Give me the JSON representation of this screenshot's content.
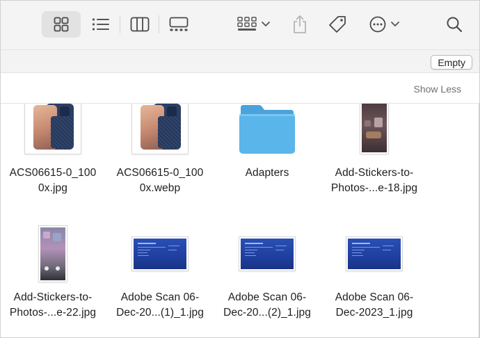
{
  "toolbar": {
    "icons": [
      "icon-view-grid-icon",
      "list-view-icon",
      "column-view-icon",
      "gallery-view-icon",
      "group-by-icon",
      "share-icon",
      "tag-icon",
      "more-actions-icon",
      "search-icon"
    ]
  },
  "header": {
    "empty_label": "Empty",
    "show_less_label": "Show Less"
  },
  "files": [
    {
      "line1": "ACS06615-0_100",
      "line2": "0x.jpg",
      "kind": "phone-photo"
    },
    {
      "line1": "ACS06615-0_100",
      "line2": "0x.webp",
      "kind": "phone-photo"
    },
    {
      "line1": "Adapters",
      "line2": "",
      "kind": "folder"
    },
    {
      "line1": "Add-Stickers-to-",
      "line2": "Photos-...e-18.jpg",
      "kind": "phone-screenshot"
    },
    {
      "line1": "Add-Stickers-to-",
      "line2": "Photos-...e-22.jpg",
      "kind": "phone-screenshot"
    },
    {
      "line1": "Adobe Scan 06-",
      "line2": "Dec-20...(1)_1.jpg",
      "kind": "scan"
    },
    {
      "line1": "Adobe Scan 06-",
      "line2": "Dec-20...(2)_1.jpg",
      "kind": "scan"
    },
    {
      "line1": "Adobe Scan 06-",
      "line2": "Dec-2023_1.jpg",
      "kind": "scan"
    }
  ],
  "colors": {
    "folder": "#5ab5ea",
    "folder_tab": "#4aa3dc",
    "scan_blue": "#1f3f9e",
    "toolbar_bg": "#f5f4f4"
  }
}
